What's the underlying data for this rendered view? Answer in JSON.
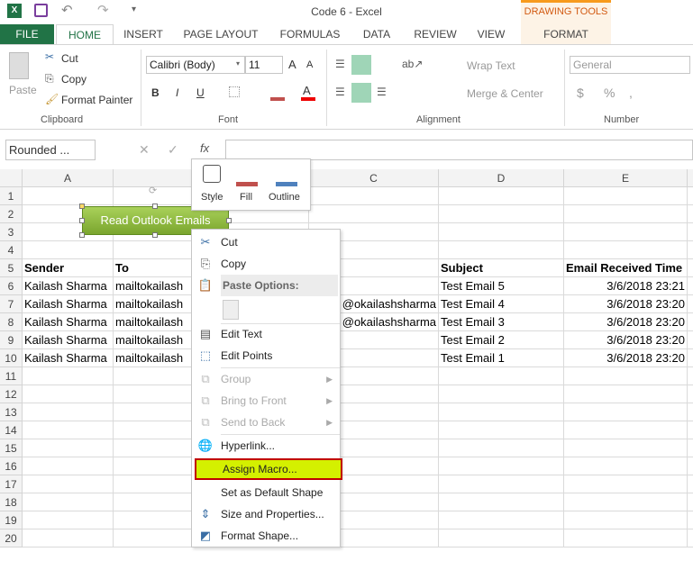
{
  "window": {
    "title": "Code 6 - Excel",
    "contextual_group": "DRAWING TOOLS"
  },
  "tabs": [
    "FILE",
    "HOME",
    "INSERT",
    "PAGE LAYOUT",
    "FORMULAS",
    "DATA",
    "REVIEW",
    "VIEW",
    "FORMAT"
  ],
  "ribbon": {
    "clipboard": {
      "paste": "Paste",
      "cut": "Cut",
      "copy": "Copy",
      "format_painter": "Format Painter",
      "label": "Clipboard"
    },
    "font": {
      "name": "Calibri (Body)",
      "size": "11",
      "bold": "B",
      "italic": "I",
      "underline": "U",
      "label": "Font"
    },
    "alignment": {
      "wrap_text": "Wrap Text",
      "merge_center": "Merge & Center",
      "label": "Alignment"
    },
    "number": {
      "format": "General",
      "currency": "$",
      "percent": "%",
      "comma": ",",
      "label": "Number"
    }
  },
  "formula_bar": {
    "name_box": "Rounded ...",
    "fx": "fx",
    "value": ""
  },
  "columns": [
    "A",
    "B",
    "C",
    "D",
    "E"
  ],
  "rows": [
    "1",
    "2",
    "3",
    "4",
    "5",
    "6",
    "7",
    "8",
    "9",
    "10",
    "11",
    "12",
    "13",
    "14",
    "15",
    "16",
    "17",
    "18",
    "19",
    "20"
  ],
  "cells": {
    "headers": [
      "Sender",
      "To",
      "",
      "Subject",
      "Email Received Time"
    ],
    "data": [
      [
        "Kailash Sharma",
        "mailtokailash",
        "",
        "Test Email 5",
        "3/6/2018 23:21"
      ],
      [
        "Kailash Sharma",
        "mailtokailash",
        "okailashsharma@",
        "Test Email 4",
        "3/6/2018 23:20"
      ],
      [
        "Kailash Sharma",
        "mailtokailash",
        "okailashsharma@",
        "Test Email 3",
        "3/6/2018 23:20"
      ],
      [
        "Kailash Sharma",
        "mailtokailash",
        "",
        "Test Email 2",
        "3/6/2018 23:20"
      ],
      [
        "Kailash Sharma",
        "mailtokailash",
        "",
        "Test Email 1",
        "3/6/2018 23:20"
      ]
    ]
  },
  "shape": {
    "text": "Read Outlook Emails",
    "color": "#8dbb3e"
  },
  "mini_toolbar": {
    "style": "Style",
    "fill": "Fill",
    "outline": "Outline"
  },
  "context_menu": {
    "cut": "Cut",
    "copy": "Copy",
    "paste_options": "Paste Options:",
    "edit_text": "Edit Text",
    "edit_points": "Edit Points",
    "group": "Group",
    "bring_to_front": "Bring to Front",
    "send_to_back": "Send to Back",
    "hyperlink": "Hyperlink...",
    "assign_macro": "Assign Macro...",
    "set_default": "Set as Default Shape",
    "size_properties": "Size and Properties...",
    "format_shape": "Format Shape...",
    "highlight_color": "#d4f000"
  }
}
